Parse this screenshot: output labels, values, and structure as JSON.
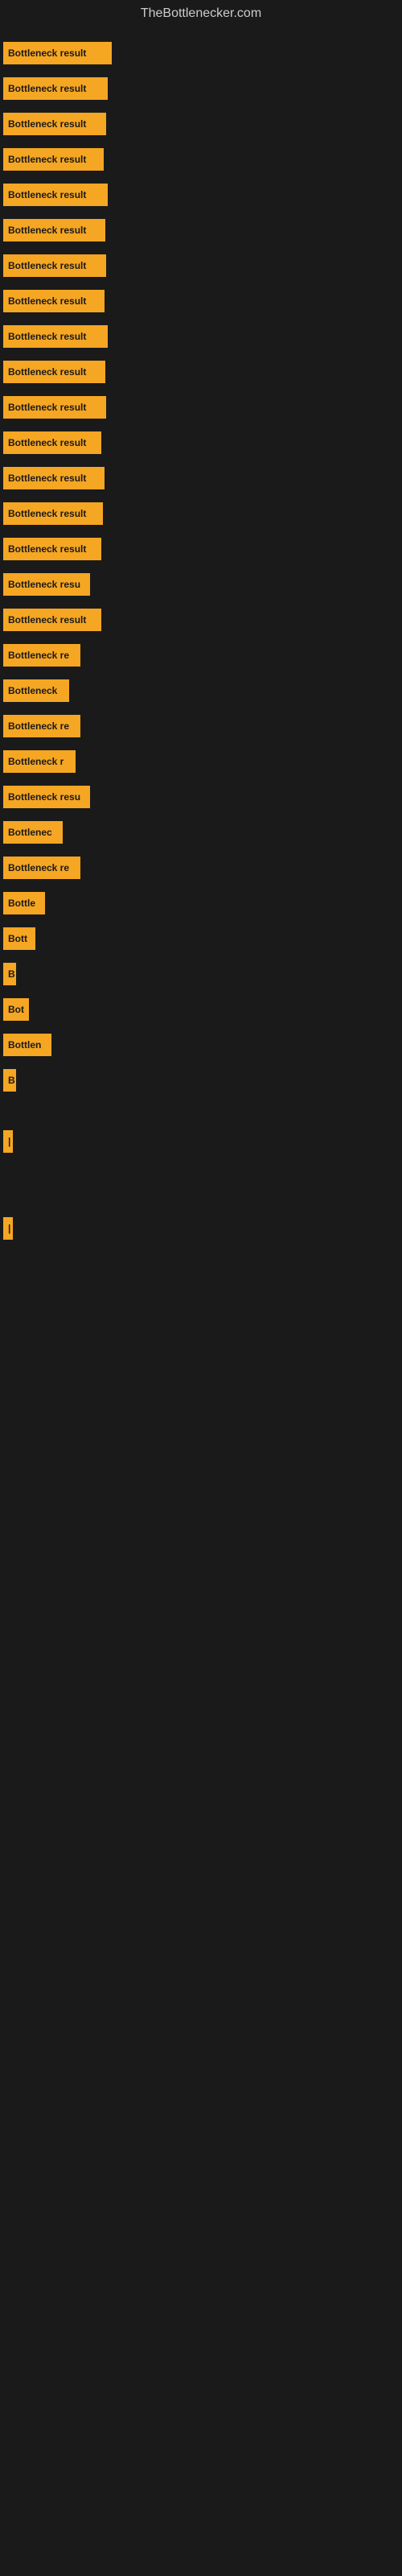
{
  "site": {
    "title": "TheBottlenecker.com"
  },
  "bars": [
    {
      "label": "Bottleneck result",
      "width": 135
    },
    {
      "label": "Bottleneck result",
      "width": 130
    },
    {
      "label": "Bottleneck result",
      "width": 128
    },
    {
      "label": "Bottleneck result",
      "width": 125
    },
    {
      "label": "Bottleneck result",
      "width": 130
    },
    {
      "label": "Bottleneck result",
      "width": 127
    },
    {
      "label": "Bottleneck result",
      "width": 128
    },
    {
      "label": "Bottleneck result",
      "width": 126
    },
    {
      "label": "Bottleneck result",
      "width": 130
    },
    {
      "label": "Bottleneck result",
      "width": 127
    },
    {
      "label": "Bottleneck result",
      "width": 128
    },
    {
      "label": "Bottleneck result",
      "width": 122
    },
    {
      "label": "Bottleneck result",
      "width": 126
    },
    {
      "label": "Bottleneck result",
      "width": 124
    },
    {
      "label": "Bottleneck result",
      "width": 122
    },
    {
      "label": "Bottleneck resu",
      "width": 108
    },
    {
      "label": "Bottleneck result",
      "width": 122
    },
    {
      "label": "Bottleneck re",
      "width": 96
    },
    {
      "label": "Bottleneck",
      "width": 82
    },
    {
      "label": "Bottleneck re",
      "width": 96
    },
    {
      "label": "Bottleneck r",
      "width": 90
    },
    {
      "label": "Bottleneck resu",
      "width": 108
    },
    {
      "label": "Bottlenec",
      "width": 74
    },
    {
      "label": "Bottleneck re",
      "width": 96
    },
    {
      "label": "Bottle",
      "width": 52
    },
    {
      "label": "Bott",
      "width": 40
    },
    {
      "label": "B",
      "width": 16
    },
    {
      "label": "Bot",
      "width": 32
    },
    {
      "label": "Bottlen",
      "width": 60
    },
    {
      "label": "B",
      "width": 16
    },
    {
      "label": "",
      "width": 0
    },
    {
      "label": "",
      "width": 0
    },
    {
      "label": "|",
      "width": 8
    },
    {
      "label": "",
      "width": 0
    },
    {
      "label": "",
      "width": 0
    },
    {
      "label": "",
      "width": 0
    },
    {
      "label": "",
      "width": 0
    },
    {
      "label": "|",
      "width": 8
    }
  ]
}
